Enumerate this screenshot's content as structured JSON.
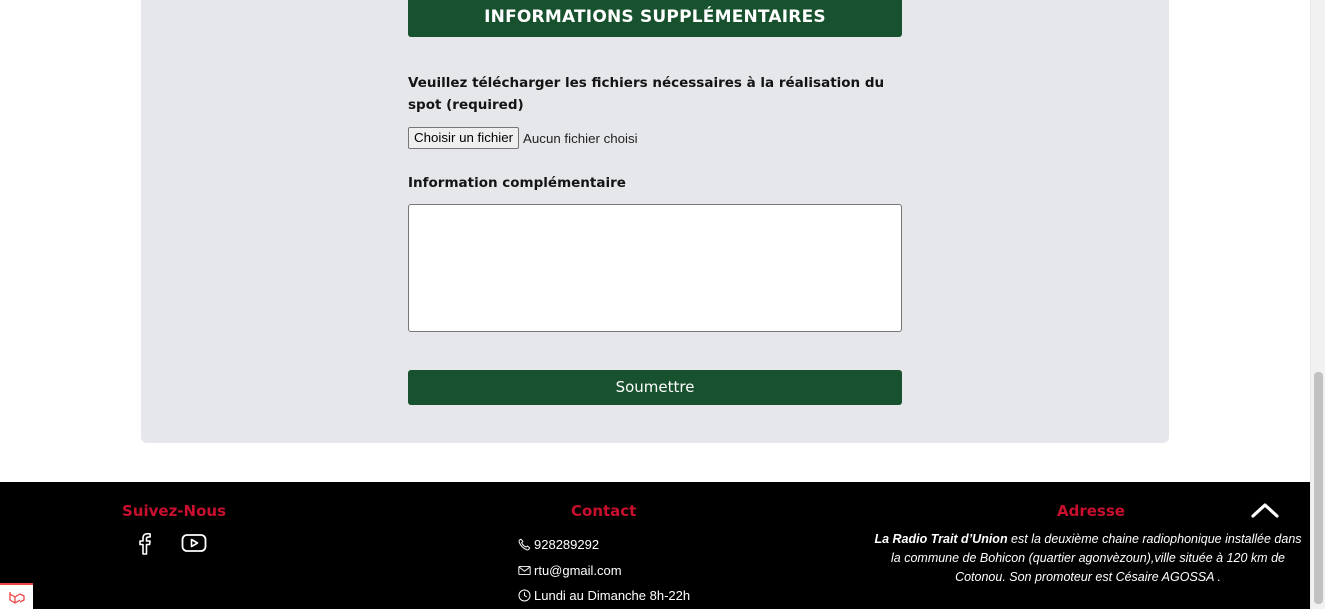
{
  "form": {
    "section_title": "INFORMATIONS SUPPLÉMENTAIRES",
    "upload_label": "Veuillez télécharger les fichiers nécessaires à la réalisation du spot (required)",
    "file_button": "Choisir un fichier",
    "file_status": "Aucun fichier choisi",
    "info_label": "Information complémentaire",
    "info_value": "",
    "submit_label": "Soumettre"
  },
  "footer": {
    "follow_title": "Suivez-Nous",
    "contact_title": "Contact",
    "address_title": "Adresse",
    "phone": "928289292",
    "email": "rtu@gmail.com",
    "hours": "Lundi au Dimanche 8h-22h",
    "address_brand": "La Radio Trait d’Union",
    "address_text": " est la deuxième chaine radiophonique installée dans la commune de Bohicon (quartier agonvèzoun),ville située à 120 km de Cotonou. Son promoteur est Césaire AGOSSA ."
  },
  "icons": {
    "facebook": "facebook-icon",
    "youtube": "youtube-icon",
    "phone": "phone-icon",
    "mail": "mail-icon",
    "clock": "clock-icon",
    "back_to_top": "chevron-up-icon"
  },
  "colors": {
    "primary_green": "#17512e",
    "accent_red": "#c8102e",
    "card_bg": "#e6e7ea",
    "footer_bg": "#000000"
  }
}
